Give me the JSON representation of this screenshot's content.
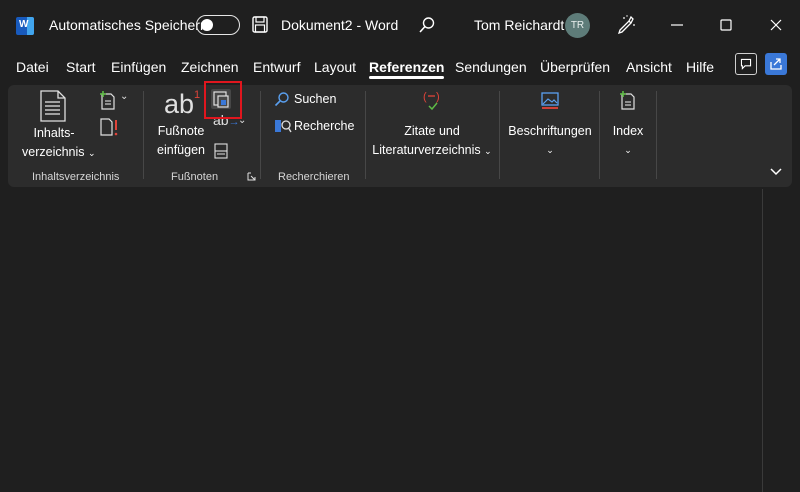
{
  "titlebar": {
    "app_icon": "word-icon",
    "app_letter": "W",
    "autosave_label": "Automatisches Speichern",
    "autosave_on": false,
    "document_title": "Dokument2 - Word",
    "user_name": "Tom Reichardt",
    "user_initials": "TR",
    "icons": [
      "save-icon",
      "search-icon",
      "pen-icon",
      "minimize-icon",
      "maximize-icon",
      "close-icon"
    ]
  },
  "tabs": [
    {
      "label": "Datei"
    },
    {
      "label": "Start"
    },
    {
      "label": "Einfügen"
    },
    {
      "label": "Zeichnen"
    },
    {
      "label": "Entwurf"
    },
    {
      "label": "Layout"
    },
    {
      "label": "Referenzen",
      "active": true
    },
    {
      "label": "Sendungen"
    },
    {
      "label": "Überprüfen"
    },
    {
      "label": "Ansicht"
    },
    {
      "label": "Hilfe"
    }
  ],
  "ribbon": {
    "toc": {
      "button_line1": "Inhalts-",
      "button_line2": "verzeichnis",
      "group_label": "Inhaltsverzeichnis"
    },
    "footnotes": {
      "insert_line1": "Fußnote",
      "insert_line2": "einfügen",
      "group_label": "Fußnoten",
      "abicon_text": "ab",
      "abicon_sup": "1",
      "small_ab": "ab"
    },
    "research": {
      "search_label": "Suchen",
      "researcher_label": "Recherche",
      "group_label": "Recherchieren"
    },
    "citations": {
      "line1": "Zitate und",
      "line2": "Literaturverzeichnis"
    },
    "captions": {
      "label": "Beschriftungen"
    },
    "index": {
      "label": "Index"
    }
  },
  "colors": {
    "background": "#1f1f1f",
    "ribbon": "#2c2c2c",
    "accent_blue": "#3a78d8",
    "highlight_red": "#e0161e",
    "avatar": "#5e7c79"
  }
}
